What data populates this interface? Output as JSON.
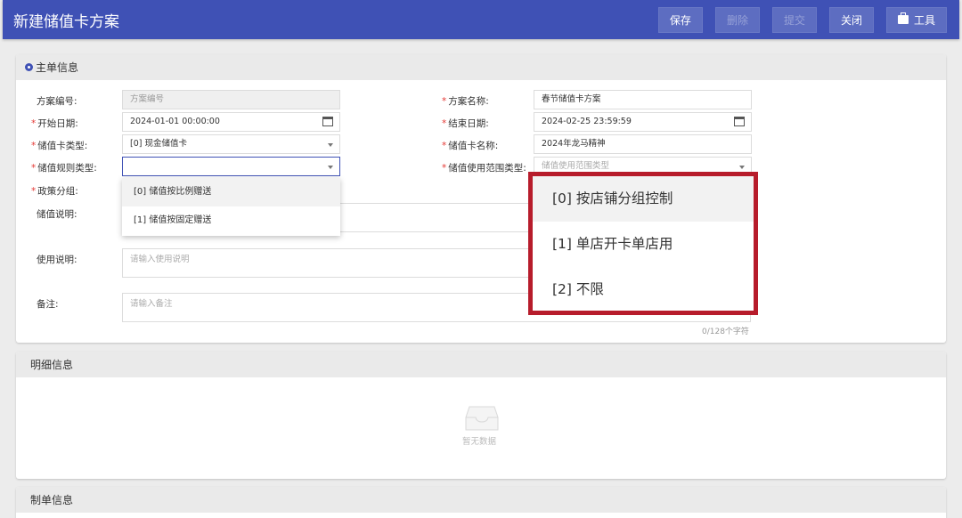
{
  "header": {
    "title": "新建储值卡方案",
    "save_label": "保存",
    "delete_label": "删除",
    "submit_label": "提交",
    "close_label": "关闭",
    "tools_label": "工具"
  },
  "main_info": {
    "title": "主单信息",
    "scheme_no": {
      "label": "方案编号:",
      "placeholder": "方案编号"
    },
    "scheme_name": {
      "label": "方案名称:",
      "value": "春节储值卡方案"
    },
    "start_date": {
      "label": "开始日期:",
      "value": "2024-01-01 00:00:00"
    },
    "end_date": {
      "label": "结束日期:",
      "value": "2024-02-25 23:59:59"
    },
    "card_type": {
      "label": "储值卡类型:",
      "value": "[0] 现金储值卡"
    },
    "card_name": {
      "label": "储值卡名称:",
      "value": "2024年龙马精神"
    },
    "rule_type": {
      "label": "储值规则类型:",
      "value": "",
      "options": [
        "[0] 储值按比例赠送",
        "[1] 储值按固定赠送"
      ]
    },
    "usage_scope_type": {
      "label": "储值使用范围类型:",
      "placeholder": "储值使用范围类型",
      "options": [
        "[0] 按店铺分组控制",
        "[1] 单店开卡单店用",
        "[2] 不限"
      ]
    },
    "policy_group": {
      "label": "政策分组:"
    },
    "card_desc": {
      "label": "储值说明:"
    },
    "usage_desc": {
      "label": "使用说明:",
      "placeholder": "请输入使用说明"
    },
    "remark": {
      "label": "备注:",
      "placeholder": "请输入备注",
      "counter": "0/128个字符"
    }
  },
  "detail_info": {
    "title": "明细信息",
    "empty_text": "暂无数据"
  },
  "maker_info": {
    "title": "制单信息"
  },
  "colors": {
    "primary": "#3f51b5",
    "highlight_border": "#b71c2b",
    "required": "#e53935"
  },
  "icons": {
    "section": "gear-icon",
    "tools": "briefcase-icon",
    "date": "calendar-icon",
    "empty": "inbox-icon"
  }
}
